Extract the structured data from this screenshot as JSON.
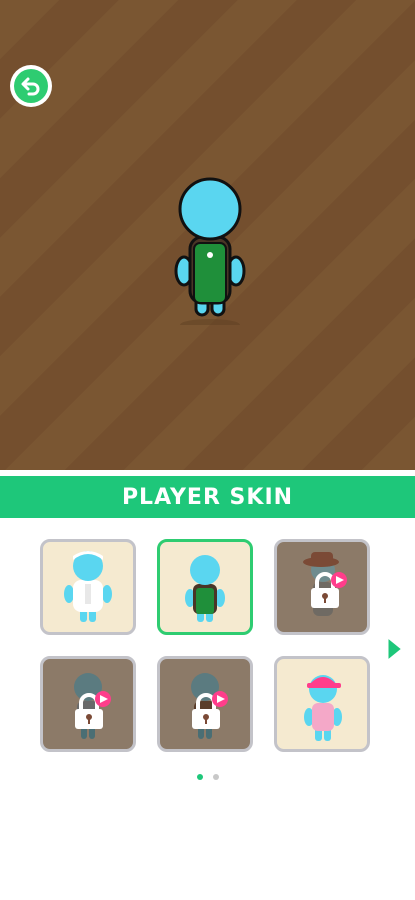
{
  "header": {
    "title": "PLAYER SKIN"
  },
  "colors": {
    "accent": "#1ec77a",
    "floor": "#7a5632",
    "skin_body": "#5ad6f0",
    "apron": "#1f8f3a",
    "locked_tile": "#8c7a68",
    "unlocked_tile": "#f5ead0",
    "video_badge": "#ff3d8b"
  },
  "skins": [
    {
      "id": "chef",
      "locked": false,
      "selected": false
    },
    {
      "id": "green-apron",
      "locked": false,
      "selected": true
    },
    {
      "id": "cowboy",
      "locked": true,
      "selected": false,
      "unlock": "watch-video"
    },
    {
      "id": "grey-shirt",
      "locked": true,
      "selected": false,
      "unlock": "watch-video"
    },
    {
      "id": "brown-apron",
      "locked": true,
      "selected": false,
      "unlock": "watch-video"
    },
    {
      "id": "pink-cap",
      "locked": false,
      "selected": false
    }
  ],
  "pagination": {
    "current_page": 1,
    "total_pages": 2
  }
}
